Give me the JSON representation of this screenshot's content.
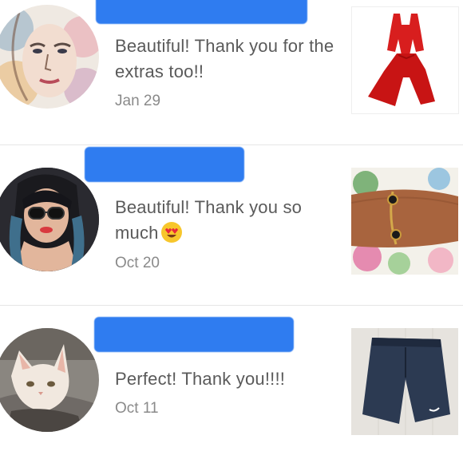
{
  "reviews": [
    {
      "comment": "Beautiful! Thank you for the extras too!!",
      "date": "Jan 29",
      "avatar_icon": "watercolor-portrait-avatar",
      "thumbnail_icon": "red-jumpsuit-thumbnail"
    },
    {
      "comment": "Beautiful! Thank you so much",
      "emoji": "heart-eyes-emoji",
      "date": "Oct 20",
      "avatar_icon": "woman-sunglasses-avatar",
      "thumbnail_icon": "bracelet-thumbnail"
    },
    {
      "comment": "Perfect! Thank you!!!!",
      "date": "Oct 11",
      "avatar_icon": "cat-avatar",
      "thumbnail_icon": "navy-shorts-thumbnail"
    }
  ],
  "colors": {
    "redaction": "#2f7cf0",
    "text": "#5a5a5a",
    "date": "#8a8a8a",
    "divider": "#e6e6e6"
  }
}
